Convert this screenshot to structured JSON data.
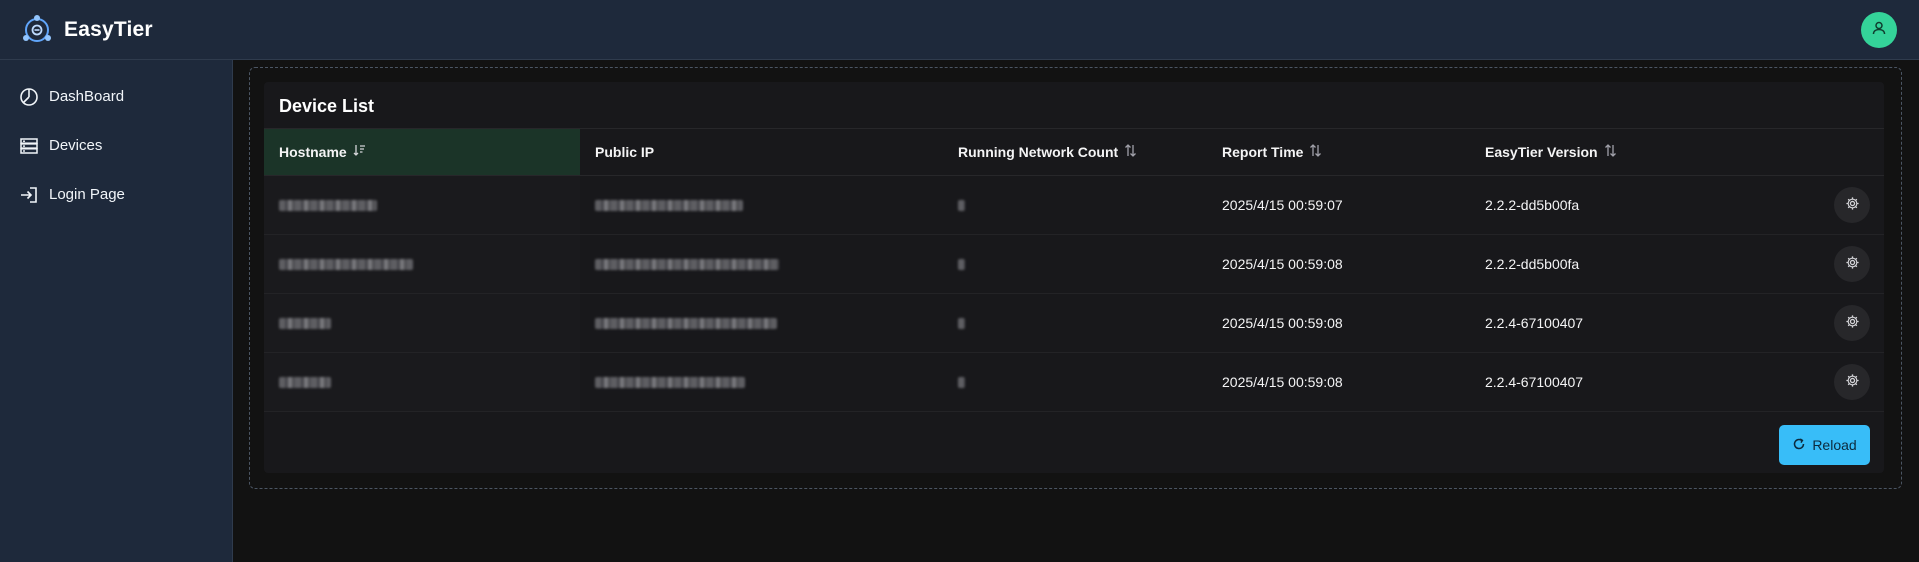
{
  "app": {
    "name": "EasyTier"
  },
  "sidebar": {
    "items": [
      {
        "label": "DashBoard",
        "icon": "dashboard-icon"
      },
      {
        "label": "Devices",
        "icon": "server-icon"
      },
      {
        "label": "Login Page",
        "icon": "sign-in-icon"
      }
    ]
  },
  "device_list": {
    "title": "Device List",
    "columns": {
      "hostname": "Hostname",
      "public_ip": "Public IP",
      "running_network_count": "Running Network Count",
      "report_time": "Report Time",
      "easytier_version": "EasyTier Version"
    },
    "rows": [
      {
        "report_time": "2025/4/15 00:59:07",
        "version": "2.2.2-dd5b00fa"
      },
      {
        "report_time": "2025/4/15 00:59:08",
        "version": "2.2.2-dd5b00fa"
      },
      {
        "report_time": "2025/4/15 00:59:08",
        "version": "2.2.4-67100407"
      },
      {
        "report_time": "2025/4/15 00:59:08",
        "version": "2.2.4-67100407"
      }
    ],
    "reload_label": "Reload"
  },
  "colors": {
    "accent": "#38bdf8",
    "avatar": "#34d399",
    "sorted_header": "#1b3428",
    "sidebar_bg": "#1e293b"
  }
}
